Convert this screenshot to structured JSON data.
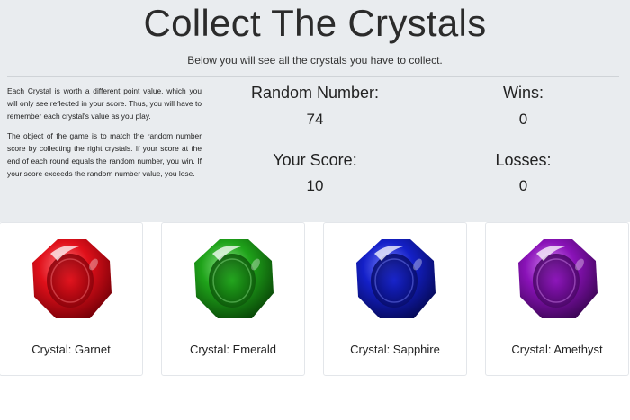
{
  "header": {
    "title": "Collect The Crystals",
    "subtitle": "Below you will see all the crystals you have to collect."
  },
  "instructions": {
    "paragraph1": "Each Crystal is worth a different point value, which you will only see reflected in your score. Thus, you will have to remember each crystal's value as you play.",
    "paragraph2": "The object of the game is to match the random number score by collecting the right crystals. If your score at the end of each round equals the random number, you win. If your score exceeds the random number value, you lose."
  },
  "stats": {
    "random_label": "Random Number:",
    "random_value": "74",
    "wins_label": "Wins:",
    "wins_value": "0",
    "score_label": "Your Score:",
    "score_value": "10",
    "losses_label": "Losses:",
    "losses_value": "0"
  },
  "crystals": [
    {
      "label": "Crystal: Garnet",
      "color": "#e0101a",
      "dark": "#7a0008",
      "light": "#ff7a80",
      "icon": "garnet-crystal-icon"
    },
    {
      "label": "Crystal: Emerald",
      "color": "#1fa31a",
      "dark": "#0a4a08",
      "light": "#8ee58a",
      "icon": "emerald-crystal-icon"
    },
    {
      "label": "Crystal: Sapphire",
      "color": "#1420c8",
      "dark": "#060a5a",
      "light": "#7a84ff",
      "icon": "sapphire-crystal-icon"
    },
    {
      "label": "Crystal: Amethyst",
      "color": "#8a12b8",
      "dark": "#3e0657",
      "light": "#d486f2",
      "icon": "amethyst-crystal-icon"
    }
  ]
}
